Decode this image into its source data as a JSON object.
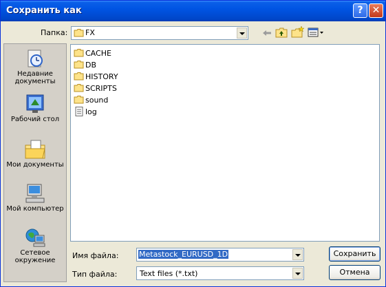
{
  "window": {
    "title": "Сохранить как"
  },
  "toolbar": {
    "folder_label": "Папка:",
    "current_folder": "FX"
  },
  "places": [
    {
      "label": "Недавние документы",
      "icon": "recent-documents-icon"
    },
    {
      "label": "Рабочий стол",
      "icon": "desktop-icon"
    },
    {
      "label": "Мои документы",
      "icon": "my-documents-icon"
    },
    {
      "label": "Мой компьютер",
      "icon": "my-computer-icon"
    },
    {
      "label": "Сетевое окружение",
      "icon": "network-icon"
    }
  ],
  "files": [
    {
      "name": "CACHE",
      "type": "folder"
    },
    {
      "name": "DB",
      "type": "folder"
    },
    {
      "name": "HISTORY",
      "type": "folder"
    },
    {
      "name": "SCRIPTS",
      "type": "folder"
    },
    {
      "name": "sound",
      "type": "folder"
    },
    {
      "name": "log",
      "type": "file"
    }
  ],
  "form": {
    "filename_label": "Имя файла:",
    "filename_value": "Metastock_EURUSD_1D",
    "filetype_label": "Тип файла:",
    "filetype_value": "Text files (*.txt)"
  },
  "buttons": {
    "save": "Сохранить",
    "cancel": "Отмена"
  }
}
